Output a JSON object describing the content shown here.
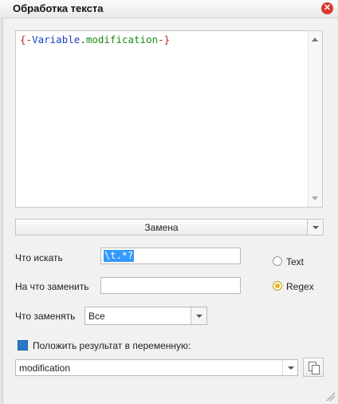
{
  "window": {
    "title": "Обработка текста"
  },
  "editor": {
    "content_parts": {
      "open": "{-",
      "variable": "Variable",
      "dot": ".",
      "name": "modification",
      "close": "-}"
    }
  },
  "mode": {
    "selected": "Замена"
  },
  "fields": {
    "find_label": "Что искать",
    "find_value": "\\t.*?",
    "replace_label": "На что заменить",
    "replace_value": "",
    "replace_which_label": "Что заменять",
    "replace_which_value": "Все"
  },
  "search_type": {
    "options": [
      {
        "label": "Text",
        "checked": false
      },
      {
        "label": "Regex",
        "checked": true
      }
    ]
  },
  "result": {
    "checkbox_label": "Положить результат в переменную:",
    "checked": true,
    "variable": "modification"
  }
}
